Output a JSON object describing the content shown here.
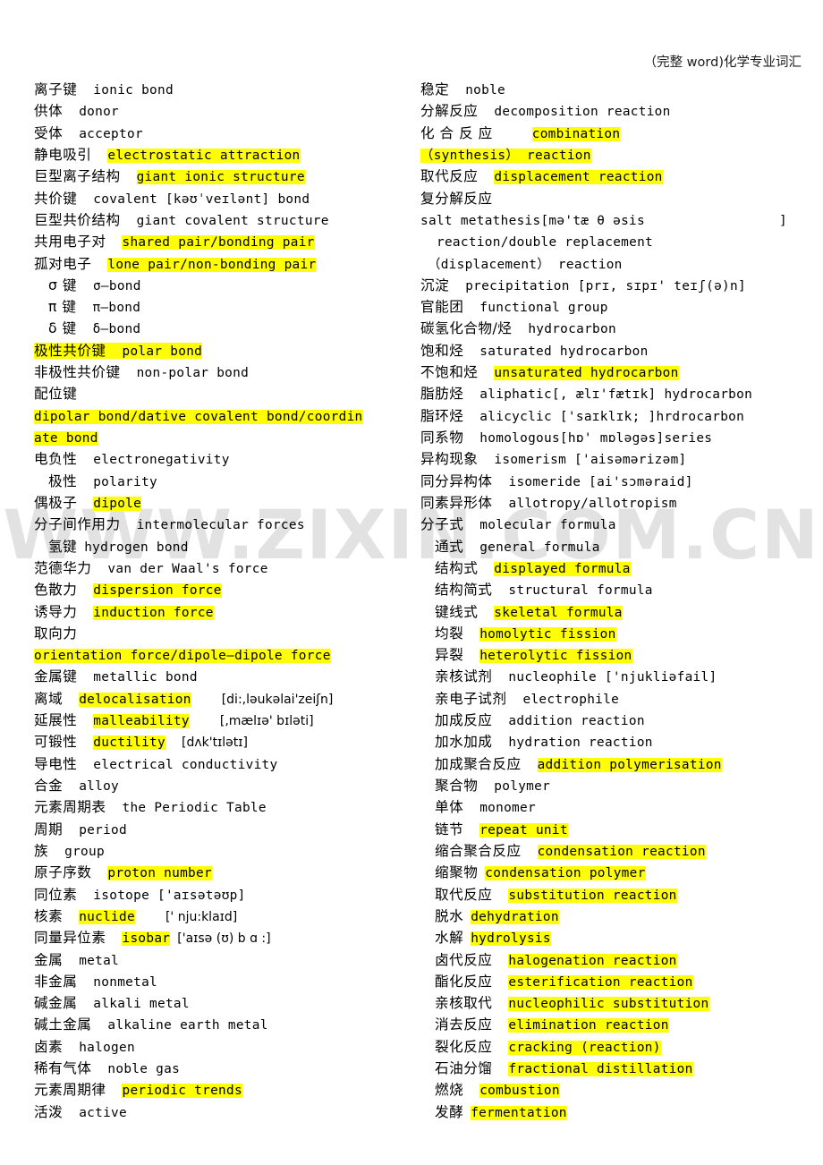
{
  "page": {
    "header": "（完整 word)化学专业词汇",
    "watermark": "WWW.ZIXIN.COM.CN",
    "highlight_color": "#ffff00",
    "text_color": "#000000",
    "background_color": "#ffffff"
  },
  "left_column": [
    {
      "cn": "离子键",
      "en": "ionic  bond"
    },
    {
      "cn": "供体",
      "en": "donor"
    },
    {
      "cn": "受体",
      "en": "acceptor"
    },
    {
      "cn": "静电吸引",
      "en": "electrostatic  attraction"
    },
    {
      "cn": "巨型离子结构",
      "en": "giant  ionic  structure"
    },
    {
      "cn": "共价键",
      "en": "covalent [kəʊˈveɪlənt]  bond"
    },
    {
      "cn": "巨型共价结构",
      "en": "giant  covalent  structure"
    },
    {
      "cn": "共用电子对",
      "en": "shared  pair/bonding  pair"
    },
    {
      "cn": "孤对电子",
      "en": "lone  pair/non-bonding  pair"
    },
    {
      "cn": "σ 键",
      "en": "σ—bond"
    },
    {
      "cn": "π 键",
      "en": "π—bond"
    },
    {
      "cn": "δ 键",
      "en": "δ—bond"
    },
    {
      "cn": "极性共价键",
      "en": "polar  bond"
    },
    {
      "cn": "非极性共价键",
      "en": "non-polar  bond"
    },
    {
      "cn": "配位键",
      "en": ""
    },
    {
      "cn": "",
      "en": "dipolar  bond/dative  covalent  bond/coordin"
    },
    {
      "cn": "",
      "en": "ate  bond"
    },
    {
      "cn": "电负性",
      "en": "electronegativity"
    },
    {
      "cn": "极性",
      "en": "polarity"
    },
    {
      "cn": "偶极子",
      "en": "dipole"
    },
    {
      "cn": "分子间作用力",
      "en": "intermolecular  forces"
    },
    {
      "cn": "氢键",
      "en": "hydrogen  bond"
    },
    {
      "cn": "范德华力",
      "en": "van  der  Waal's  force"
    },
    {
      "cn": "色散力",
      "en": "dispersion  force"
    },
    {
      "cn": "诱导力",
      "en": "induction  force"
    },
    {
      "cn": "取向力",
      "en": ""
    },
    {
      "cn": "",
      "en": "orientation  force/dipole—dipole  force"
    },
    {
      "cn": "金属键",
      "en": "metallic  bond"
    },
    {
      "cn": "离域",
      "en": "delocalisation",
      "ipa": "[di:,ləukəlai'zeiʃn]"
    },
    {
      "cn": "延展性",
      "en": "malleability",
      "ipa": "[,mælɪə' bɪləti]"
    },
    {
      "cn": "可锻性",
      "en": "ductility",
      "ipa": "[dʌk'tɪlətɪ]"
    },
    {
      "cn": "导电性",
      "en": "electrical  conductivity"
    },
    {
      "cn": "合金",
      "en": "alloy"
    },
    {
      "cn": "元素周期表",
      "en": "the  Periodic  Table"
    },
    {
      "cn": "周期",
      "en": "period"
    },
    {
      "cn": "族",
      "en": "group"
    },
    {
      "cn": "原子序数",
      "en": "proton  number"
    },
    {
      "cn": "同位素",
      "en": "isotope ['aɪsətəʊp]"
    },
    {
      "cn": "核素",
      "en": "nuclide",
      "ipa": "[' nju:klaɪd]"
    },
    {
      "cn": "同量异位素",
      "en": "isobar",
      "ipa": "['aɪsə (ʊ) b ɑ :]"
    },
    {
      "cn": "金属",
      "en": "metal"
    },
    {
      "cn": "非金属",
      "en": "nonmetal"
    },
    {
      "cn": "碱金属",
      "en": "alkali  metal"
    },
    {
      "cn": "碱土金属",
      "en": "alkaline  earth  metal"
    },
    {
      "cn": "卤素",
      "en": "halogen"
    },
    {
      "cn": "稀有气体",
      "en": "noble  gas"
    },
    {
      "cn": "元素周期律",
      "en": "periodic  trends"
    },
    {
      "cn": "活泼",
      "en": "active"
    }
  ],
  "right_column": [
    {
      "cn": "稳定",
      "en": "noble"
    },
    {
      "cn": "分解反应",
      "en": "decomposition  reaction"
    },
    {
      "cn": "化    合    反    应",
      "en": "combination"
    },
    {
      "cn": "",
      "en": "（synthesis）  reaction"
    },
    {
      "cn": "取代反应",
      "en": "displacement  reaction"
    },
    {
      "cn": "复分解反应",
      "en": ""
    },
    {
      "cn": "",
      "en": "salt  metathesis[mə'tæ θ əsis",
      "trail": "]"
    },
    {
      "cn": "",
      "en": "reaction/double  replacement"
    },
    {
      "cn": "",
      "en": "（displacement）  reaction"
    },
    {
      "cn": "沉淀",
      "en": "precipitation  [prɪ, sɪpɪ' teɪʃ(ə)n]"
    },
    {
      "cn": "官能团",
      "en": "functional  group"
    },
    {
      "cn": "碳氢化合物/烃",
      "en": "hydrocarbon"
    },
    {
      "cn": "饱和烃",
      "en": "saturated  hydrocarbon"
    },
    {
      "cn": "不饱和烃",
      "en": "unsaturated  hydrocarbon"
    },
    {
      "cn": "脂肪烃",
      "en": "aliphatic[, ælɪ'fætɪk]  hydrocarbon"
    },
    {
      "cn": "脂环烃",
      "en": "alicyclic  ['saɪklɪk; ]hrdrocarbon"
    },
    {
      "cn": "同系物",
      "en": "homologous[hɒ' mɒləgəs]series"
    },
    {
      "cn": "异构现象",
      "en": "isomerism  ['aisəmərizəm]"
    },
    {
      "cn": "同分异构体",
      "en": "isomeride  [ai'sɔməraid]"
    },
    {
      "cn": "同素异形体",
      "en": "allotropy/allotropism"
    },
    {
      "cn": "分子式",
      "en": "molecular  formula"
    },
    {
      "cn": "通式",
      "en": "general  formula"
    },
    {
      "cn": "结构式",
      "en": "displayed  formula"
    },
    {
      "cn": "结构简式",
      "en": "structural  formula"
    },
    {
      "cn": "键线式",
      "en": "skeletal  formula"
    },
    {
      "cn": "均裂",
      "en": "homolytic  fission"
    },
    {
      "cn": "异裂",
      "en": "heterolytic  fission"
    },
    {
      "cn": "亲核试剂",
      "en": "nucleophile  ['njukliəfail]"
    },
    {
      "cn": "亲电子试剂",
      "en": "electrophile"
    },
    {
      "cn": "加成反应",
      "en": "addition  reaction"
    },
    {
      "cn": "加水加成",
      "en": "hydration  reaction"
    },
    {
      "cn": "加成聚合反应",
      "en": "addition  polymerisation"
    },
    {
      "cn": "聚合物",
      "en": "polymer"
    },
    {
      "cn": "单体",
      "en": "monomer"
    },
    {
      "cn": "链节",
      "en": "repeat  unit"
    },
    {
      "cn": "缩合聚合反应",
      "en": "condensation  reaction"
    },
    {
      "cn": "缩聚物",
      "en": "condensation  polymer"
    },
    {
      "cn": "取代反应",
      "en": "substitution  reaction"
    },
    {
      "cn": "脱水",
      "en": "dehydration"
    },
    {
      "cn": "水解",
      "en": "hydrolysis"
    },
    {
      "cn": "卤代反应",
      "en": "halogenation  reaction"
    },
    {
      "cn": "酯化反应",
      "en": "esterification  reaction"
    },
    {
      "cn": "亲核取代",
      "en": "nucleophilic  substitution"
    },
    {
      "cn": "消去反应",
      "en": "elimination  reaction"
    },
    {
      "cn": "裂化反应",
      "en": "cracking  (reaction)"
    },
    {
      "cn": "石油分馏",
      "en": "fractional  distillation"
    },
    {
      "cn": "燃烧",
      "en": "combustion"
    },
    {
      "cn": "发酵",
      "en": "fermentation"
    }
  ]
}
